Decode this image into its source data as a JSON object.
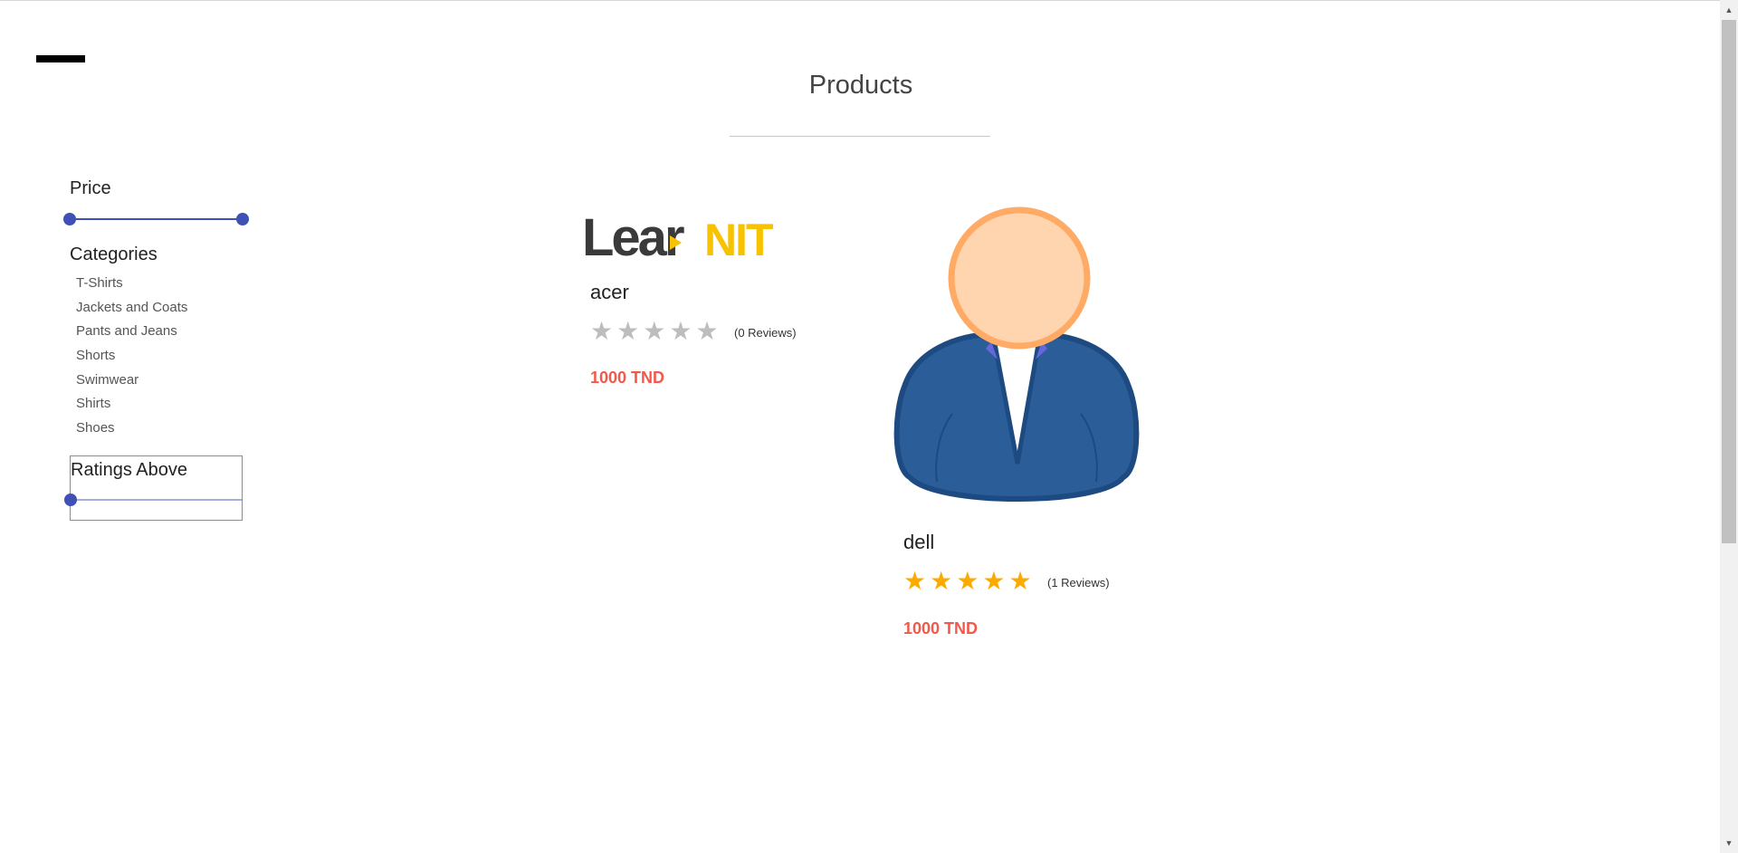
{
  "page": {
    "title": "Products"
  },
  "filters": {
    "price_label": "Price",
    "categories_label": "Categories",
    "categories": [
      "T-Shirts",
      "Jackets and Coats",
      "Pants and Jeans",
      "Shorts",
      "Swimwear",
      "Shirts",
      "Shoes"
    ],
    "ratings_label": "Ratings Above"
  },
  "products": [
    {
      "name": "acer",
      "reviews": "(0 Reviews)",
      "price": "1000 TND",
      "rating": 0,
      "image": "learnit-logo"
    },
    {
      "name": "dell",
      "reviews": "(1 Reviews)",
      "price": "1000 TND",
      "rating": 5,
      "image": "user-avatar"
    }
  ],
  "logo_text": {
    "left": "Lear",
    "right": "NIT"
  },
  "colors": {
    "accent": "#3f51b5",
    "price": "#f2594b",
    "star": "#fcaa00",
    "star_empty": "#bdbdbd",
    "logo_yellow": "#f7c200",
    "logo_dark": "#3a3a3a"
  }
}
